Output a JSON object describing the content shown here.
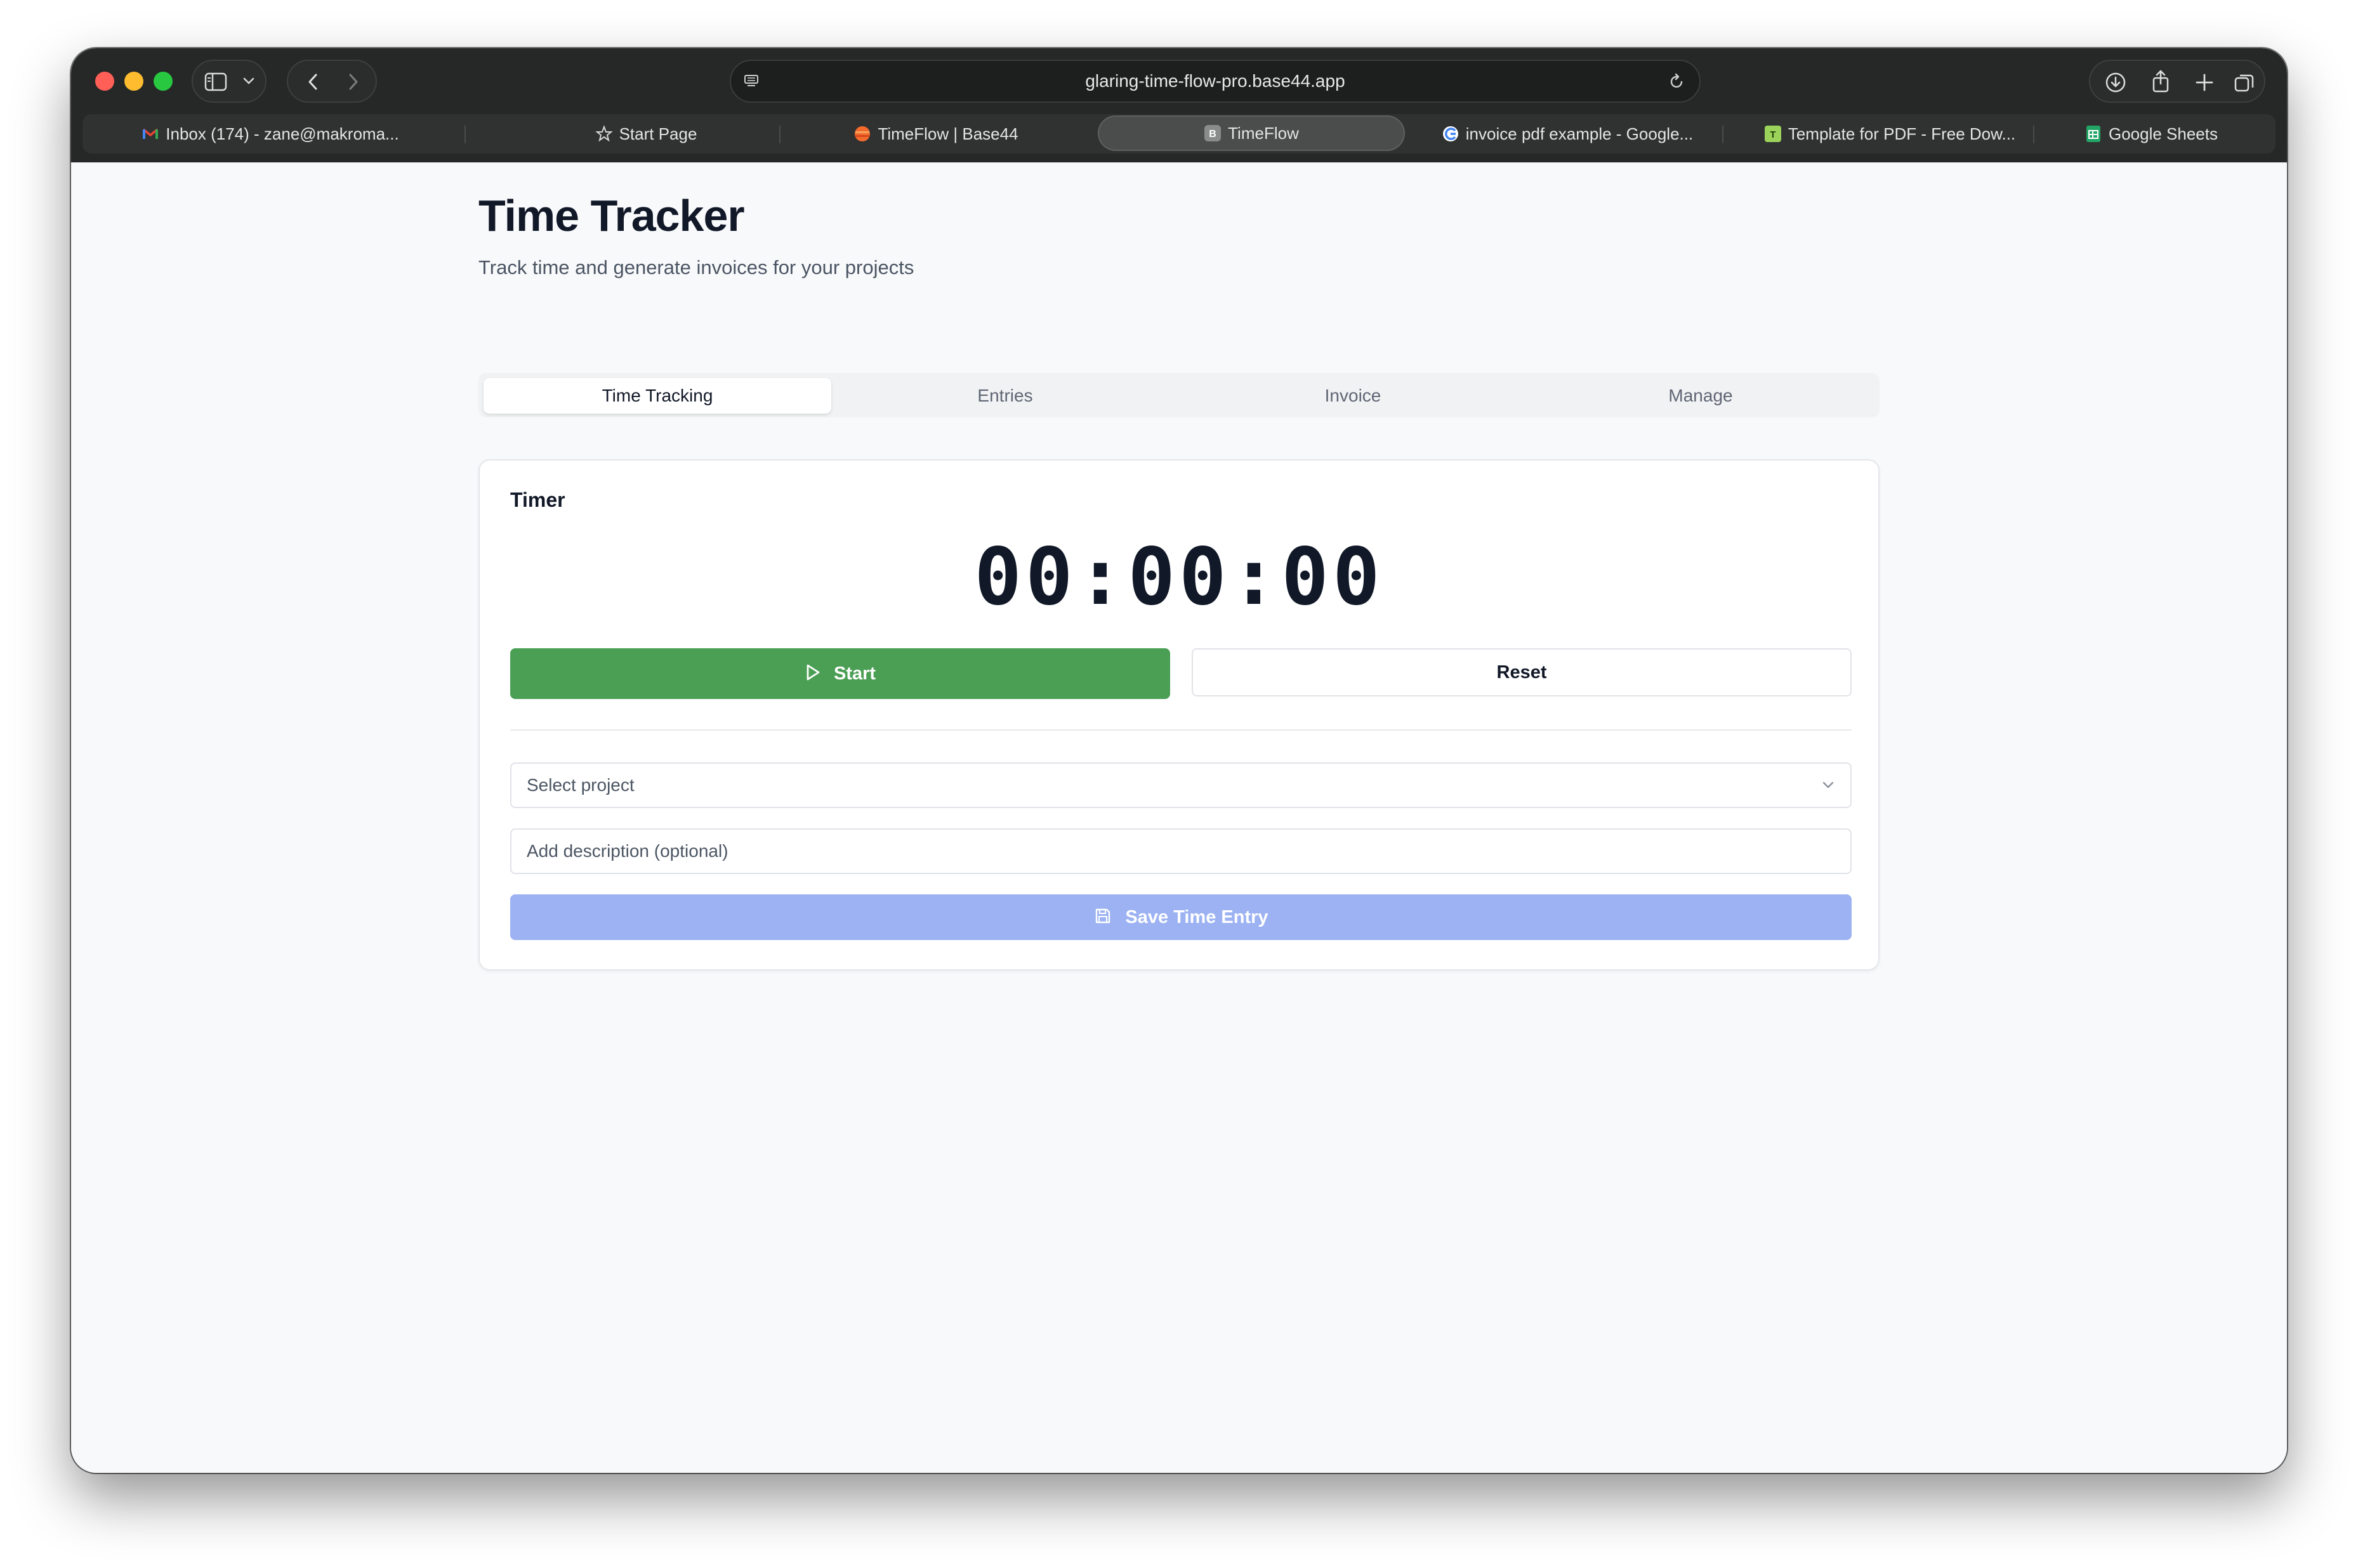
{
  "browser": {
    "url": "glaring-time-flow-pro.base44.app",
    "tabs": [
      {
        "label": "Inbox (174) - zane@makroma...",
        "icon": "gmail-icon",
        "active": false
      },
      {
        "label": "Start Page",
        "icon": "star-icon",
        "active": false
      },
      {
        "label": "TimeFlow | Base44",
        "icon": "base44-icon",
        "active": false
      },
      {
        "label": "TimeFlow",
        "icon": "b-badge-icon",
        "active": true
      },
      {
        "label": "invoice pdf example - Google...",
        "icon": "google-icon",
        "active": false
      },
      {
        "label": "Template for PDF - Free Dow...",
        "icon": "template-icon",
        "active": false
      },
      {
        "label": "Google Sheets",
        "icon": "sheets-icon",
        "active": false
      }
    ]
  },
  "header": {
    "title": "Time Tracker",
    "subtitle": "Track time and generate invoices for your projects"
  },
  "nav": {
    "tabs": [
      {
        "label": "Time Tracking",
        "active": true
      },
      {
        "label": "Entries",
        "active": false
      },
      {
        "label": "Invoice",
        "active": false
      },
      {
        "label": "Manage",
        "active": false
      }
    ]
  },
  "timer": {
    "title": "Timer",
    "display": "00:00:00",
    "start_label": "Start",
    "reset_label": "Reset",
    "project_placeholder": "Select project",
    "description_placeholder": "Add description (optional)",
    "save_label": "Save Time Entry"
  },
  "colors": {
    "start_button": "#4b9f55",
    "save_button_disabled": "#9cb2f2",
    "browser_chrome": "#262827"
  }
}
